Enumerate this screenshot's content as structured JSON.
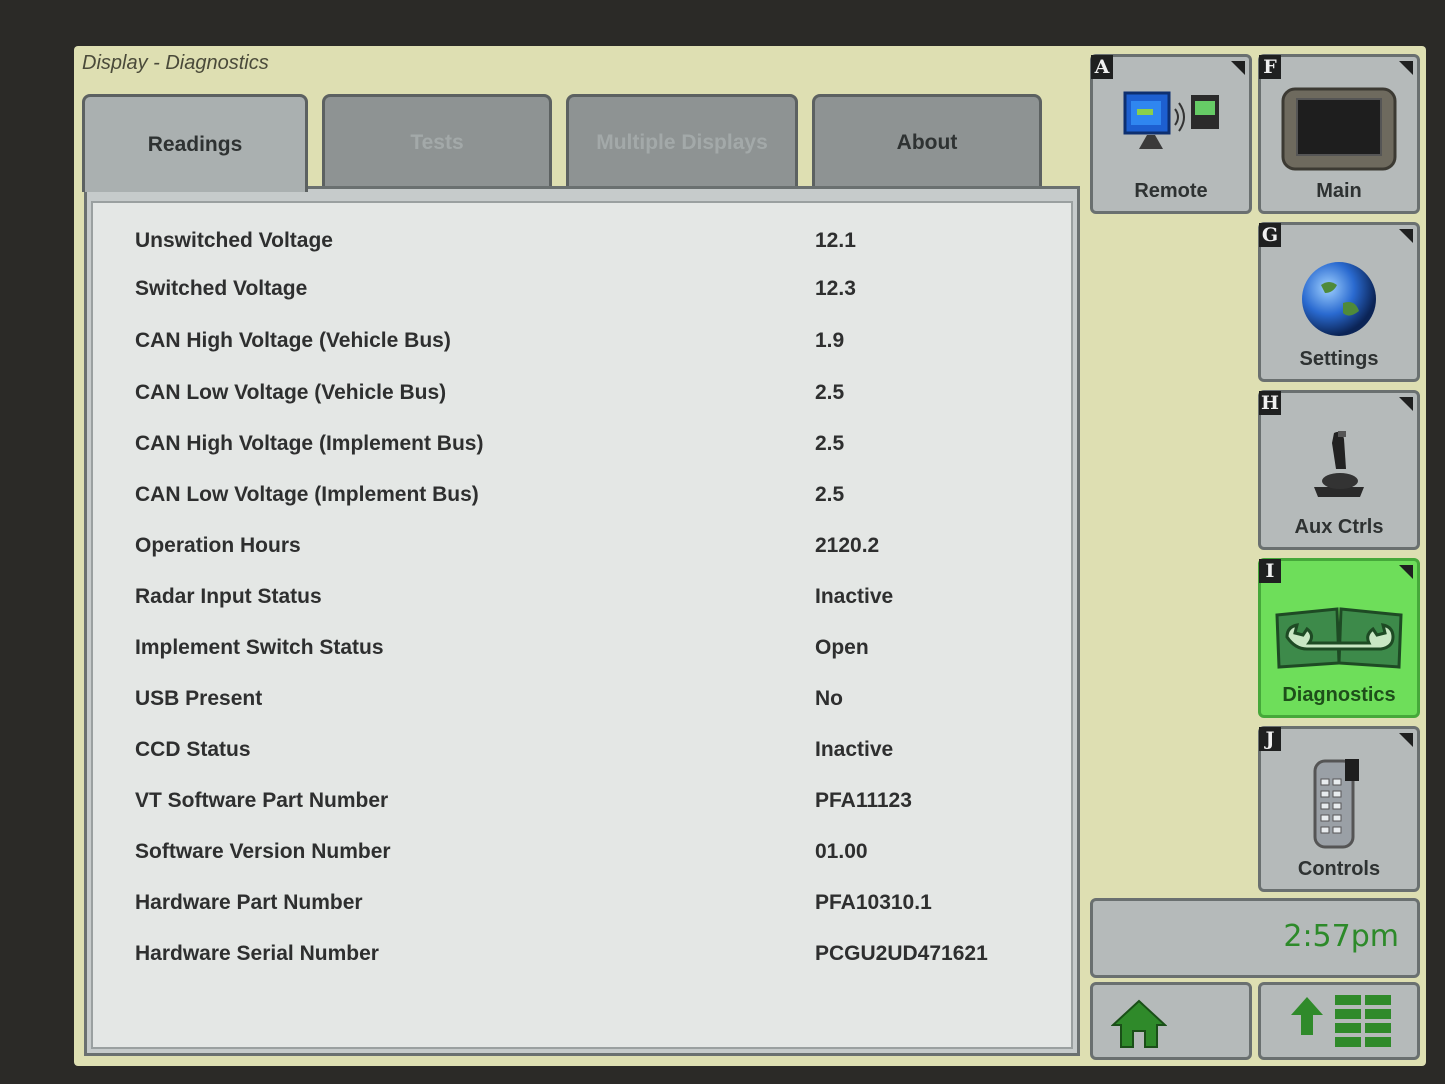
{
  "window_title": "Display - Diagnostics",
  "tabs": [
    {
      "label": "Readings",
      "state": "active"
    },
    {
      "label": "Tests",
      "state": "disabled"
    },
    {
      "label": "Multiple Displays",
      "state": "disabled"
    },
    {
      "label": "About",
      "state": "enabled"
    }
  ],
  "readings": [
    {
      "label": "Unswitched Voltage",
      "value": "12.1"
    },
    {
      "label": "Switched Voltage",
      "value": "12.3"
    },
    {
      "label": "CAN High Voltage (Vehicle Bus)",
      "value": "1.9"
    },
    {
      "label": "CAN Low Voltage (Vehicle Bus)",
      "value": "2.5"
    },
    {
      "label": "CAN High Voltage (Implement Bus)",
      "value": "2.5"
    },
    {
      "label": "CAN Low Voltage (Implement Bus)",
      "value": "2.5"
    },
    {
      "label": "Operation Hours",
      "value": "2120.2"
    },
    {
      "label": "Radar Input Status",
      "value": "Inactive"
    },
    {
      "label": "Implement Switch Status",
      "value": "Open"
    },
    {
      "label": "USB Present",
      "value": "No"
    },
    {
      "label": "CCD Status",
      "value": "Inactive"
    },
    {
      "label": "VT Software Part Number",
      "value": "PFA11123"
    },
    {
      "label": "Software Version Number",
      "value": "01.00"
    },
    {
      "label": "Hardware Part Number",
      "value": "PFA10310.1"
    },
    {
      "label": "Hardware Serial Number",
      "value": "PCGU2UD471621"
    }
  ],
  "side_buttons": {
    "remote": {
      "key": "A",
      "label": "Remote",
      "icon": "remote-display-icon"
    },
    "main": {
      "key": "F",
      "label": "Main",
      "icon": "display-unit-icon"
    },
    "settings": {
      "key": "G",
      "label": "Settings",
      "icon": "globe-icon"
    },
    "aux_ctrls": {
      "key": "H",
      "label": "Aux Ctrls",
      "icon": "joystick-icon"
    },
    "diagnostics": {
      "key": "I",
      "label": "Diagnostics",
      "icon": "wrench-book-icon",
      "state": "active"
    },
    "controls": {
      "key": "J",
      "label": "Controls",
      "icon": "remote-control-icon"
    }
  },
  "clock": "2:57pm",
  "nav": {
    "home_icon": "home-icon",
    "menu_icon": "up-arrow-menu-icon"
  },
  "colors": {
    "active_button": "#6ede5a",
    "clock_text": "#2d8a2a",
    "screen_bg": "#dedfb2"
  }
}
